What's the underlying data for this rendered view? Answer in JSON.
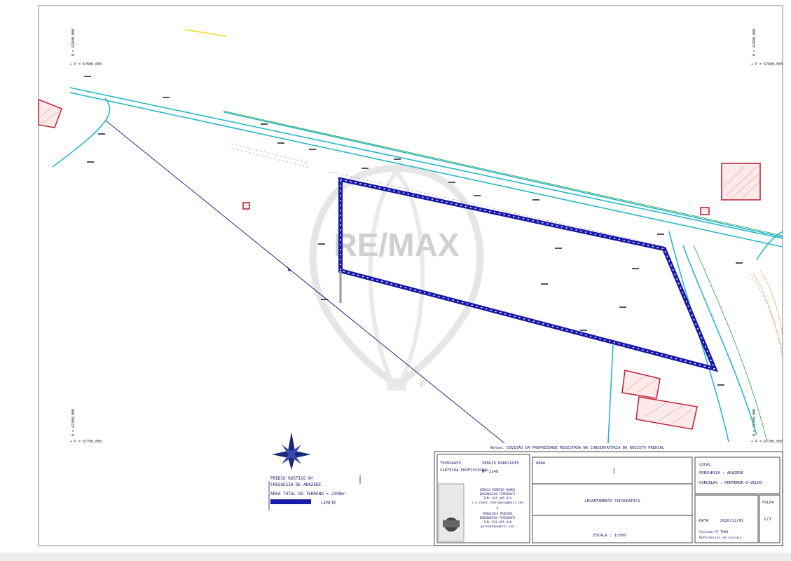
{
  "drawing": {
    "coord_labels": {
      "top_left_n": "N = 42400,000",
      "top_left_p": "+ P = 67600,000",
      "top_right_n": "N = 42400,000",
      "top_right_p": "+ P = 67600,000",
      "bottom_left_n": "N = 42300,000",
      "bottom_left_p": "+ P = 67700,000",
      "bottom_right_n": "N = 42300,000",
      "bottom_right_p": "+ P = 67700,000"
    },
    "watermark": "RE/MAX",
    "watermark_mark": "®",
    "caption_top": "Notas: DIVISÃO DA PROPRIEDADE REGISTADA NA CONSERVATÓRIA DO REGISTO PREDIAL",
    "legend": {
      "line1": "PRÉDIO RÚSTICO Nº",
      "line2": "FREGUESIA DE ARAZEDE",
      "line3": "ÁREA TOTAL DO TERRENO = 2390m²",
      "line4": "LIMITE"
    },
    "colors": {
      "boundary": "#1a1aa8",
      "road": "#27b8c8",
      "building": "#c0283a",
      "line": "#1f2a80"
    },
    "icons": [
      "north-arrow-icon",
      "remax-balloon-icon"
    ]
  },
  "title_block": {
    "topografo_label": "TOPÓGRAFO",
    "topografo_value": "SÉRGIO RODRIGUES",
    "cartao_label": "CARTEIRA PROFISSIONAL",
    "cartao_value": "Nº 2148",
    "contact_1": "SÉRGIO PEREIRA RAMOS",
    "contact_2": "ENGENHEIRO TOPÓGRAFO",
    "contact_3": "TLM: 935 485 974",
    "contact_4": "s.p.ramos.rodrigues@gmail.com",
    "contact_5": "&",
    "contact_6": "FRANCISCO PEREIRA",
    "contact_7": "ENGENHEIRO TOPÓGRAFO",
    "contact_8": "TLM: 936 655 418",
    "contact_9": "geral@topogeral.com",
    "obra_label": "OBRA",
    "obra_value": "]",
    "title_value": "LEVANTAMENTO TOPOGRÁFICO",
    "escala_label": "ESCALA : 1/500",
    "local_label": "LOCAL",
    "freguesia": "FREGUESIA : ARAZEDE",
    "concelho": "CONCELHO : MONTEMOR-O-VELHO",
    "data_label": "DATA",
    "data_value": "2020/12/01",
    "folha_label": "FOLHA",
    "folha_value": "1/1",
    "sistema_1": "Sistema PT-TM06",
    "sistema_2": "Referencial de Cascais"
  }
}
